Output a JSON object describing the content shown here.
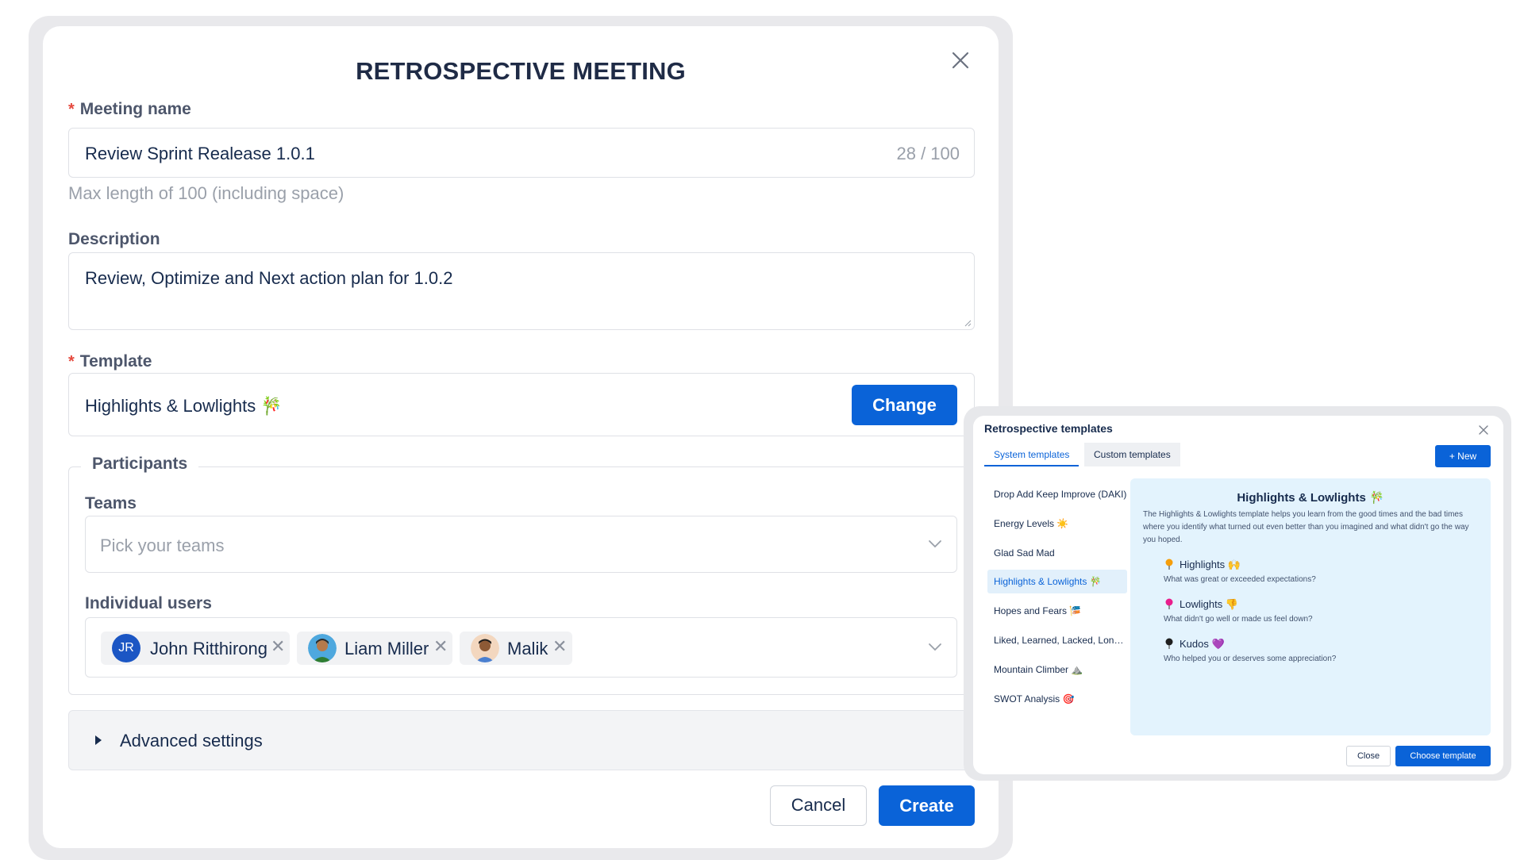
{
  "meeting_modal": {
    "title": "RETROSPECTIVE MEETING",
    "meeting_name": {
      "label": "Meeting name",
      "value": "Review Sprint Realease 1.0.1",
      "counter": "28 / 100",
      "helper": "Max length of 100 (including space)"
    },
    "description": {
      "label": "Description",
      "value": "Review, Optimize and Next action plan for 1.0.2"
    },
    "template": {
      "label": "Template",
      "value": "Highlights & Lowlights 🎋",
      "change_label": "Change"
    },
    "participants": {
      "legend": "Participants",
      "teams_label": "Teams",
      "teams_placeholder": "Pick your teams",
      "users_label": "Individual users",
      "users": [
        {
          "initials": "JR",
          "name": "John Ritthirong"
        },
        {
          "name": "Liam Miller"
        },
        {
          "name": "Malik"
        }
      ]
    },
    "advanced_settings": "Advanced settings",
    "cancel_label": "Cancel",
    "create_label": "Create",
    "required_mark": "*",
    "remove_glyph": "✕"
  },
  "templates_popup": {
    "title": "Retrospective templates",
    "tabs": [
      "System templates",
      "Custom templates"
    ],
    "new_label": "+  New",
    "list": [
      "Drop Add Keep Improve (DAKI)",
      "Energy Levels ☀️",
      "Glad Sad Mad",
      "Highlights & Lowlights 🎋",
      "Hopes and Fears 🎏",
      "Liked, Learned, Lacked, Longed for",
      "Mountain Climber ⛰️",
      "SWOT Analysis 🎯"
    ],
    "selected_index": 3,
    "preview": {
      "title": "Highlights & Lowlights 🎋",
      "description": "The Highlights & Lowlights template helps you learn from the good times and the bad times where you identify what turned out even better than you imagined and what didn't go the way you hoped.",
      "columns": [
        {
          "title": "Highlights 🙌",
          "question": "What was great or exceeded expectations?",
          "color": "#f59e0b"
        },
        {
          "title": "Lowlights 👎",
          "question": "What didn't go well or made us feel down?",
          "color": "#e91e8c"
        },
        {
          "title": "Kudos 💜",
          "question": "Who helped you or deserves some appreciation?",
          "color": "#1f1f1f"
        }
      ]
    },
    "close_label": "Close",
    "choose_label": "Choose template"
  },
  "colors": {
    "primary": "#0a63d8",
    "required": "#e5483d",
    "preview_bg": "#e3f3fd"
  }
}
